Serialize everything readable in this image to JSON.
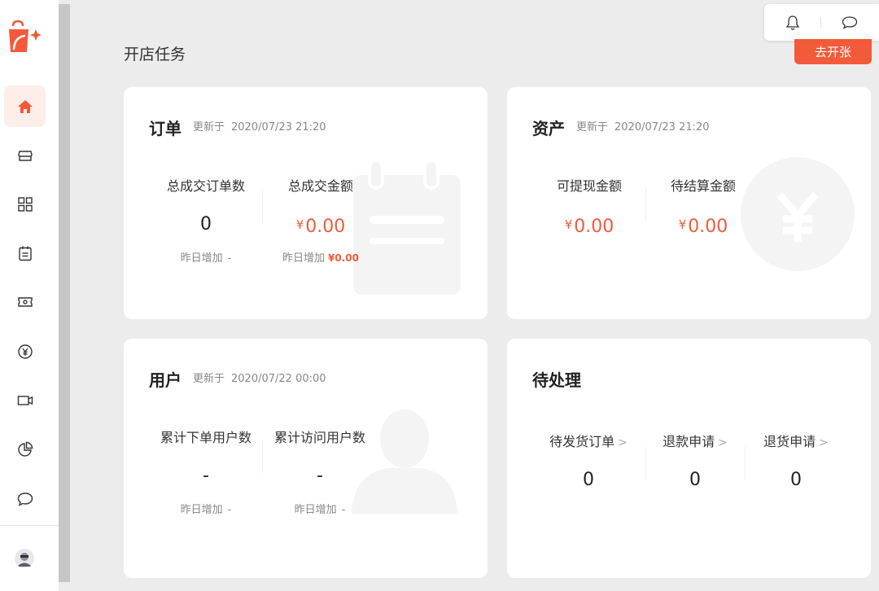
{
  "page": {
    "title": "开店任务"
  },
  "top": {
    "open_button": "去开张"
  },
  "sidebar": {
    "items": [
      {
        "name": "home",
        "icon": "home-icon",
        "active": true
      },
      {
        "name": "shop",
        "icon": "store-icon"
      },
      {
        "name": "apps",
        "icon": "grid-icon"
      },
      {
        "name": "orders",
        "icon": "clipboard-icon"
      },
      {
        "name": "coupons",
        "icon": "ticket-icon"
      },
      {
        "name": "finance",
        "icon": "yen-circle-icon"
      },
      {
        "name": "video",
        "icon": "video-icon"
      },
      {
        "name": "analytics",
        "icon": "pie-chart-icon"
      },
      {
        "name": "messages",
        "icon": "chat-icon"
      }
    ]
  },
  "orders": {
    "title": "订单",
    "updated_label": "更新于",
    "updated_time": "2020/07/23 21:20",
    "total_orders_label": "总成交订单数",
    "total_orders_value": "0",
    "total_orders_sub_label": "昨日增加",
    "total_orders_sub_value": "-",
    "total_amount_label": "总成交金额",
    "total_amount_symbol": "¥",
    "total_amount_value": "0.00",
    "total_amount_sub_label": "昨日增加",
    "total_amount_sub_value": "¥0.00"
  },
  "assets": {
    "title": "资产",
    "updated_label": "更新于",
    "updated_time": "2020/07/23 21:20",
    "withdrawable_label": "可提现金额",
    "withdrawable_symbol": "¥",
    "withdrawable_value": "0.00",
    "pending_label": "待结算金额",
    "pending_symbol": "¥",
    "pending_value": "0.00"
  },
  "users": {
    "title": "用户",
    "updated_label": "更新于",
    "updated_time": "2020/07/22 00:00",
    "order_users_label": "累计下单用户数",
    "order_users_value": "-",
    "order_users_sub_label": "昨日增加",
    "order_users_sub_value": "-",
    "visit_users_label": "累计访问用户数",
    "visit_users_value": "-",
    "visit_users_sub_label": "昨日增加",
    "visit_users_sub_value": "-"
  },
  "pending": {
    "title": "待处理",
    "ship_label": "待发货订单",
    "ship_value": "0",
    "refund_label": "退款申请",
    "refund_value": "0",
    "return_label": "退货申请",
    "return_value": "0"
  },
  "colors": {
    "accent": "#f25a3a",
    "active_bg": "#fdeeea",
    "background": "#ececec"
  }
}
